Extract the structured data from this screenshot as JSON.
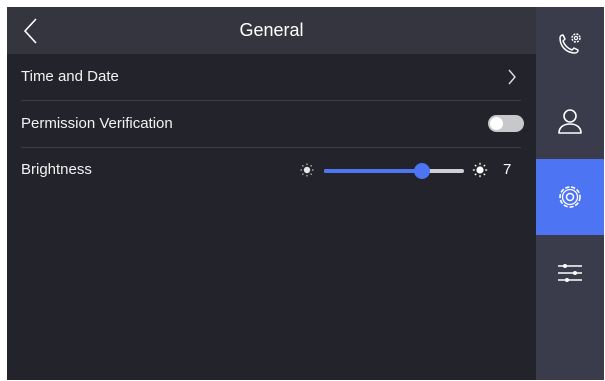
{
  "header": {
    "title": "General",
    "back_icon": "chevron-left-icon"
  },
  "rows": {
    "time_date": {
      "label": "Time and Date",
      "icon": "chevron-right-icon"
    },
    "permission": {
      "label": "Permission Verification",
      "toggle_on": false
    },
    "brightness": {
      "label": "Brightness",
      "value": "7",
      "level": 7,
      "max": 10
    }
  },
  "sidebar": {
    "items": [
      {
        "icon": "call-settings-icon",
        "active": false
      },
      {
        "icon": "user-icon",
        "active": false
      },
      {
        "icon": "gear-icon",
        "active": true
      },
      {
        "icon": "sliders-icon",
        "active": false
      }
    ]
  },
  "colors": {
    "accent": "#4d74f2",
    "background": "#23232b",
    "header": "#34353f",
    "sidebar": "#3b3c4b"
  }
}
